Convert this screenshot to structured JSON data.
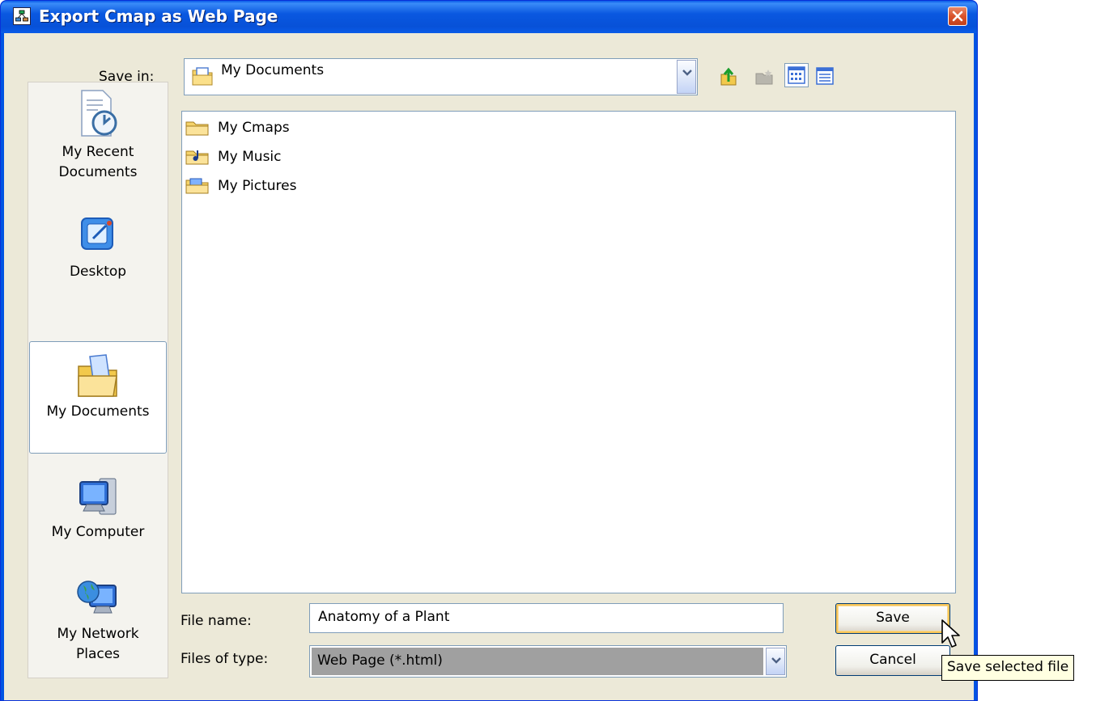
{
  "window": {
    "title": "Export Cmap as Web Page",
    "icons": {
      "app": "cmap-icon",
      "close": "close-icon"
    }
  },
  "save_in": {
    "label": "Save in:",
    "value": "My Documents",
    "icon": "my-documents-folder-icon"
  },
  "toolbar": {
    "buttons": [
      {
        "name": "up-one-level-button",
        "icon": "up-folder-icon",
        "enabled": true
      },
      {
        "name": "create-new-folder-button",
        "icon": "new-folder-icon",
        "enabled": false
      },
      {
        "name": "list-view-button",
        "icon": "list-view-icon",
        "active": true
      },
      {
        "name": "details-view-button",
        "icon": "details-view-icon",
        "active": false
      }
    ]
  },
  "places": [
    {
      "label_line1": "My Recent",
      "label_line2": "Documents",
      "icon": "recent-documents-icon",
      "selected": false
    },
    {
      "label_line1": "Desktop",
      "label_line2": "",
      "icon": "desktop-icon",
      "selected": false
    },
    {
      "label_line1": "My Documents",
      "label_line2": "",
      "icon": "my-documents-icon",
      "selected": true
    },
    {
      "label_line1": "My Computer",
      "label_line2": "",
      "icon": "my-computer-icon",
      "selected": false
    },
    {
      "label_line1": "My Network",
      "label_line2": "Places",
      "icon": "network-places-icon",
      "selected": false
    }
  ],
  "files": [
    {
      "name": "My Cmaps",
      "icon": "folder-icon"
    },
    {
      "name": "My Music",
      "icon": "music-folder-icon"
    },
    {
      "name": "My Pictures",
      "icon": "pictures-folder-icon"
    }
  ],
  "file_name": {
    "label": "File name:",
    "value": "Anatomy of a Plant"
  },
  "file_type": {
    "label": "Files of type:",
    "value": "Web Page (*.html)"
  },
  "buttons": {
    "save": "Save",
    "cancel": "Cancel"
  },
  "tooltip": "Save selected file",
  "colors": {
    "titlebar": "#0054e3",
    "dialog_bg": "#ece9d8",
    "field_border": "#7f9db9",
    "tooltip_bg": "#ffffe1",
    "default_button_focus": "#f9c556"
  }
}
